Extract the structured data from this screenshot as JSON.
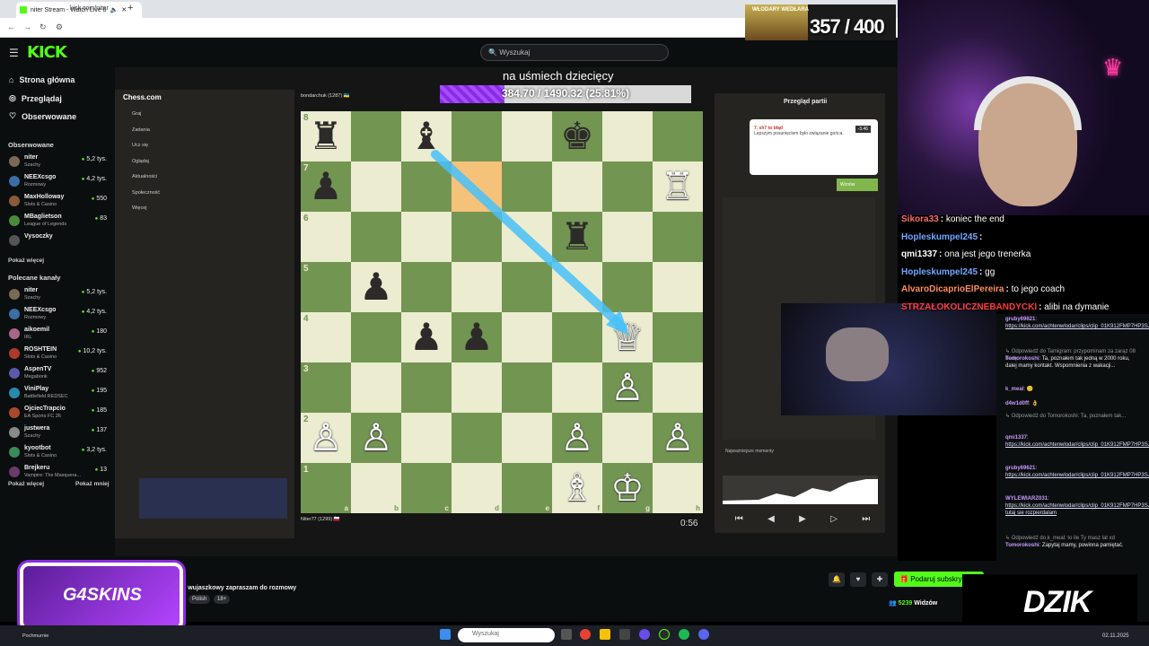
{
  "browser": {
    "tab_title": "niter Stream - Watch Live o",
    "url": "kick.com/niter"
  },
  "kick": {
    "logo": "KICK",
    "search_placeholder": "Wyszukaj",
    "nav": [
      {
        "label": "Strona główna",
        "icon": "home-icon"
      },
      {
        "label": "Przeglądaj",
        "icon": "compass-icon"
      },
      {
        "label": "Obserwowane",
        "icon": "heart-icon"
      }
    ],
    "followed_header": "Obserwowane",
    "followed": [
      {
        "name": "niter",
        "category": "Szachy",
        "viewers": "5,2 tys.",
        "color": "#7a6a55"
      },
      {
        "name": "NEEXcsgo",
        "category": "Rozmowy",
        "viewers": "4,2 tys.",
        "color": "#3a6ea5"
      },
      {
        "name": "MaxHolloway",
        "category": "Slots & Casino",
        "viewers": "550",
        "color": "#8a5a3a"
      },
      {
        "name": "MBaglietson",
        "category": "League of Legends",
        "viewers": "83",
        "color": "#4a8a3a"
      },
      {
        "name": "Vysoczky",
        "category": "",
        "viewers": "",
        "color": "#555555"
      }
    ],
    "show_more_1": "Pokaż więcej",
    "recommended_header": "Polecane kanały",
    "recommended": [
      {
        "name": "niter",
        "category": "Szachy",
        "viewers": "5,2 tys.",
        "color": "#7a6a55"
      },
      {
        "name": "NEEXcsgo",
        "category": "Rozmowy",
        "viewers": "4,2 tys.",
        "color": "#3a6ea5"
      },
      {
        "name": "aikoemil",
        "category": "IRL",
        "viewers": "180",
        "color": "#aa6688"
      },
      {
        "name": "ROSHTEIN",
        "category": "Slots & Casino",
        "viewers": "10,2 tys.",
        "color": "#b03a2a"
      },
      {
        "name": "AspenTV",
        "category": "Megabonk",
        "viewers": "952",
        "color": "#5a5aaa"
      },
      {
        "name": "ViniPlay",
        "category": "Battlefield REDSEC",
        "viewers": "195",
        "color": "#2a8aaa"
      },
      {
        "name": "OjciecTrapcio",
        "category": "EA Sports FC 26",
        "viewers": "185",
        "color": "#aa4a2a"
      },
      {
        "name": "justwera",
        "category": "Szachy",
        "viewers": "137",
        "color": "#8a8a8a"
      },
      {
        "name": "kyootbot",
        "category": "Slots & Casino",
        "viewers": "3,2 tys.",
        "color": "#3a8a5a"
      },
      {
        "name": "Brejkeru",
        "category": "Vampire: The Masquera...",
        "viewers": "13",
        "color": "#6a3a6a"
      }
    ],
    "show_more_2": "Pokaż więcej",
    "show_less": "Pokaż mniej"
  },
  "stream": {
    "overlay_title": "na uśmiech dziecięcy",
    "goal_text": "384.70 / 1490.32 (25.81%)",
    "goal_progress": 0.2581,
    "sub_goal": "357 / 400",
    "sub_goal_label": "WŁODARY WEDŁARA",
    "chess": {
      "logo": "Chess.com",
      "menu": [
        "Graj",
        "Zadania",
        "Ucz się",
        "Oglądaj",
        "Aktualności",
        "Społeczność",
        "Więcej"
      ],
      "player_top": "bondarchuk (1287) 🇺🇦",
      "player_bottom": "Niter77 (1299) 🇵🇱",
      "clock_top": "0:56",
      "clock_bottom": "0:56",
      "review_title": "Przegląd partii",
      "hint_text": "Lepszym posunięciem było związanie gońca.",
      "hint_badge": "-3.46",
      "hint_move": "7. sh7 to błąd",
      "best_button": "Wznów",
      "bottom_label": "Najważniejsze momenty"
    }
  },
  "overlay_chat": [
    {
      "user": "Sikora33",
      "color": "#ff6b6b",
      "msg": "koniec the end"
    },
    {
      "user": "Hopleskumpel245",
      "color": "#6fa8ff",
      "msg": ""
    },
    {
      "user": "qmi1337",
      "color": "#ffffff",
      "msg": "ona jest jego trenerka"
    },
    {
      "user": "Hopleskumpel245",
      "color": "#6fa8ff",
      "msg": "gg"
    },
    {
      "user": "AlvaroDicaprioElPereira",
      "color": "#ff8c5a",
      "msg": "to jego coach"
    },
    {
      "user": "STRZAŁOKOLICZNEBANDYCKI",
      "color": "#ff3a3a",
      "msg": "alibi na dymanie"
    }
  ],
  "kick_chat": [
    {
      "user": "gruby69621",
      "text": "https://kick.com/achtenwlodar/clips/clip_01K912FMP7HP3SJFWC0MYSN2Y0",
      "link": true
    },
    {
      "user": "",
      "text": "↳ Odpowiedź do Tamigram: przypominam za zarąz 08 bedę",
      "reply": true
    },
    {
      "user": "Tomorokoshi",
      "text": "Ta, poznałem tak jedną w 2000 roku, dalej mamy kontakt. Wspomnienia z wakacji...",
      "link": false
    },
    {
      "user": "k_meal",
      "text": "🙂",
      "link": false
    },
    {
      "user": "d4w1d0ff",
      "text": "👌",
      "link": false
    },
    {
      "user": "",
      "text": "↳ Odpowiedź do Tomorokoshi: Ta, poznałem tak...",
      "reply": true
    },
    {
      "user": "qmi1337",
      "text": "https://kick.com/achtenwlodar/clips/clip_01K912FMP7HP3SJFWC0MYSN2Y0",
      "link": true
    },
    {
      "user": "gruby69621",
      "text": "https://kick.com/achtenwlodar/clips/clip_01K912FMP7HP3SJFWC0MYSN2Y0",
      "link": true
    },
    {
      "user": "WYLEWIARZ031",
      "text": "https://kick.com/achtenwlodar/clips/clip_01K912FMP7HP3SJFWC0MYSN2Y0 tutaj sie rozpierdalam",
      "link": true
    },
    {
      "user": "",
      "text": "↳ Odpowiedź do k_meal: to ile Ty masz lat xd",
      "reply": true
    },
    {
      "user": "Tomorokoshi",
      "text": "Zapytaj mamy, powinna pamiętać.",
      "link": false
    }
  ],
  "info": {
    "stream_title": "h wujaszkowy zapraszam do rozmowy",
    "tags": [
      "Polish",
      "18+"
    ],
    "subscribe": "Podaruj subskry",
    "viewers": "5239",
    "viewers_label": "Widzów",
    "sponsor_left": "G4SKINS",
    "sponsor_right": "DZIK"
  },
  "taskbar": {
    "weather": "Pochmurnie",
    "search_placeholder": "Wyszukaj",
    "date": "02.11.2025"
  }
}
